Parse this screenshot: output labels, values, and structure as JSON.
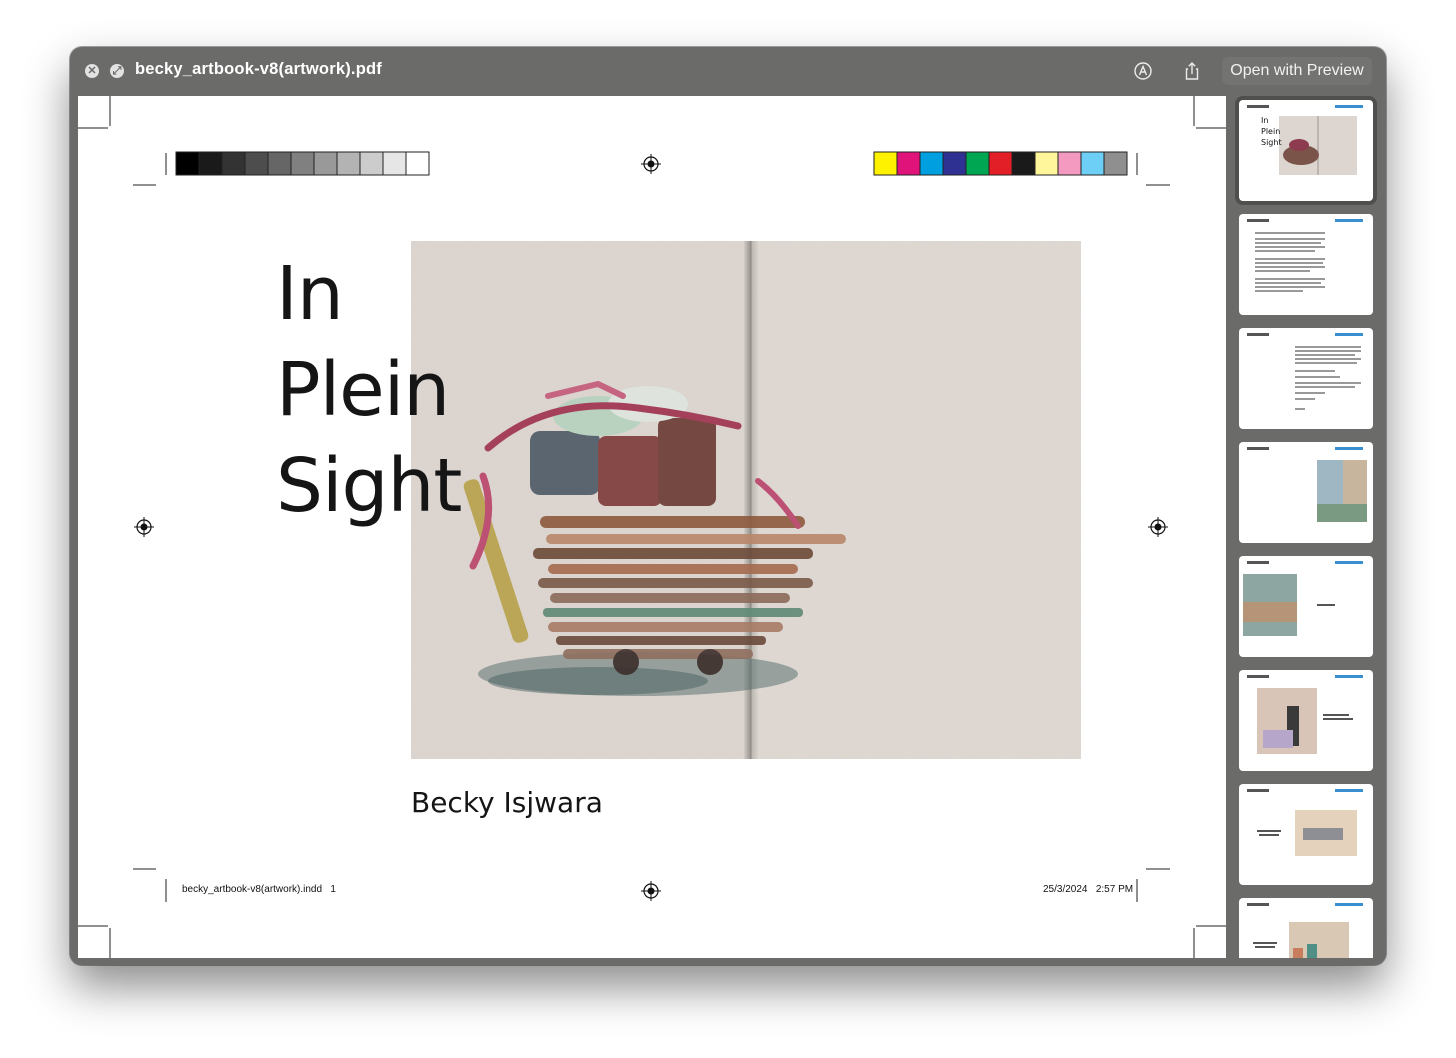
{
  "window": {
    "title": "becky_artbook-v8(artwork).pdf",
    "open_with_label": "Open with Preview"
  },
  "page": {
    "title_lines": [
      "In",
      "Plein",
      "Sight"
    ],
    "author": "Becky Isjwara",
    "slug_file": "becky_artbook-v8(artwork).indd   1",
    "slug_date": "25/3/2024   2:57 PM",
    "grayscale_bar": [
      "#000000",
      "#1a1a1a",
      "#333333",
      "#4d4d4d",
      "#666666",
      "#808080",
      "#999999",
      "#b3b3b3",
      "#cccccc",
      "#e6e6e6",
      "#ffffff"
    ],
    "color_bar": [
      "#fff200",
      "#e0137a",
      "#00a0e0",
      "#2e3192",
      "#00a651",
      "#e21e26",
      "#1a1a1a",
      "#fff59a",
      "#f49ac1",
      "#6dcff6",
      "#8f8f8f"
    ]
  },
  "sidebar": {
    "thumbnail_count": 8,
    "thumb1_lines": [
      "In",
      "Plein",
      "Sight"
    ]
  }
}
